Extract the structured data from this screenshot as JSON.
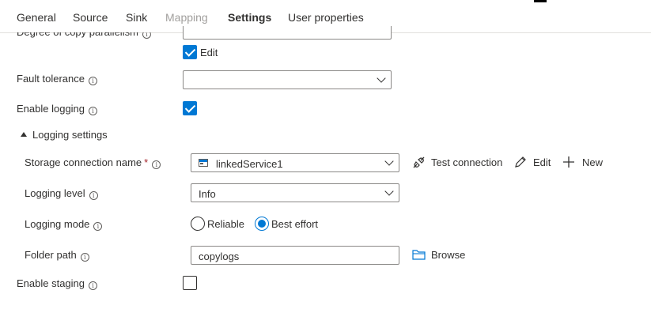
{
  "tabs": [
    {
      "label": "General"
    },
    {
      "label": "Source"
    },
    {
      "label": "Sink"
    },
    {
      "label": "Mapping"
    },
    {
      "label": "Settings"
    },
    {
      "label": "User properties"
    }
  ],
  "active_tab": "Settings",
  "parallel_copies": {
    "label": "Degree of copy parallelism",
    "value": "",
    "edit_label": "Edit",
    "edit_checked": true
  },
  "fault_tolerance": {
    "label": "Fault tolerance",
    "value": ""
  },
  "enable_logging": {
    "label": "Enable logging",
    "checked": true
  },
  "logging_settings": {
    "header": "Logging settings",
    "storage": {
      "label": "Storage connection name",
      "required_mark": "*",
      "value": "linkedService1",
      "test_connection": "Test connection",
      "edit": "Edit",
      "new": "New"
    },
    "level": {
      "label": "Logging level",
      "value": "Info"
    },
    "mode": {
      "label": "Logging mode",
      "options": [
        "Reliable",
        "Best effort"
      ],
      "selected": "Best effort"
    },
    "folder": {
      "label": "Folder path",
      "value": "copylogs",
      "browse": "Browse"
    }
  },
  "enable_staging": {
    "label": "Enable staging",
    "checked": false
  },
  "colors": {
    "accent": "#0078d4",
    "text": "#323130",
    "border": "#8a8886",
    "required": "#a4262c"
  }
}
